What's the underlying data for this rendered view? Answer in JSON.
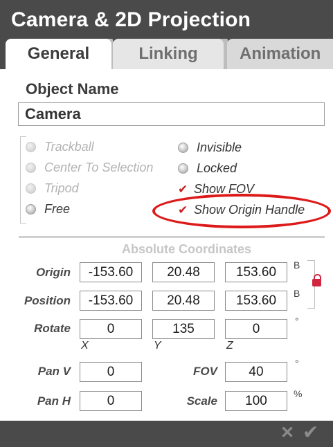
{
  "title": "Camera & 2D Projection",
  "tabs": [
    "General",
    "Linking",
    "Animation"
  ],
  "object_name": {
    "label": "Object Name",
    "value": "Camera"
  },
  "modes": [
    {
      "label": "Trackball",
      "selected": false,
      "enabled": false
    },
    {
      "label": "Center To Selection",
      "selected": false,
      "enabled": false
    },
    {
      "label": "Tripod",
      "selected": false,
      "enabled": false
    },
    {
      "label": "Free",
      "selected": true,
      "enabled": true
    }
  ],
  "options": [
    {
      "label": "Invisible",
      "type": "radio",
      "checked": false
    },
    {
      "label": "Locked",
      "type": "radio",
      "checked": false
    },
    {
      "label": "Show FOV",
      "type": "checkbox",
      "checked": true
    },
    {
      "label": "Show Origin Handle",
      "type": "checkbox",
      "checked": true
    }
  ],
  "coords": {
    "title": "Absolute Coordinates",
    "rows": [
      {
        "label": "Origin",
        "values": [
          "-153.60",
          "20.48",
          "153.60"
        ],
        "unit": "B"
      },
      {
        "label": "Position",
        "values": [
          "-153.60",
          "20.48",
          "153.60"
        ],
        "unit": "B"
      },
      {
        "label": "Rotate",
        "values": [
          "0",
          "135",
          "0"
        ],
        "unit": "°"
      }
    ],
    "axes": [
      "X",
      "Y",
      "Z"
    ]
  },
  "lens": {
    "pan_v": {
      "label": "Pan V",
      "value": "0"
    },
    "pan_h": {
      "label": "Pan H",
      "value": "0"
    },
    "fov": {
      "label": "FOV",
      "value": "40",
      "unit": "°"
    },
    "scale": {
      "label": "Scale",
      "value": "100",
      "unit": "%"
    }
  },
  "footer": {
    "cancel": "✕",
    "ok": "✔"
  },
  "colors": {
    "accent": "#dd1a1a",
    "bar": "#4a4a4a"
  }
}
